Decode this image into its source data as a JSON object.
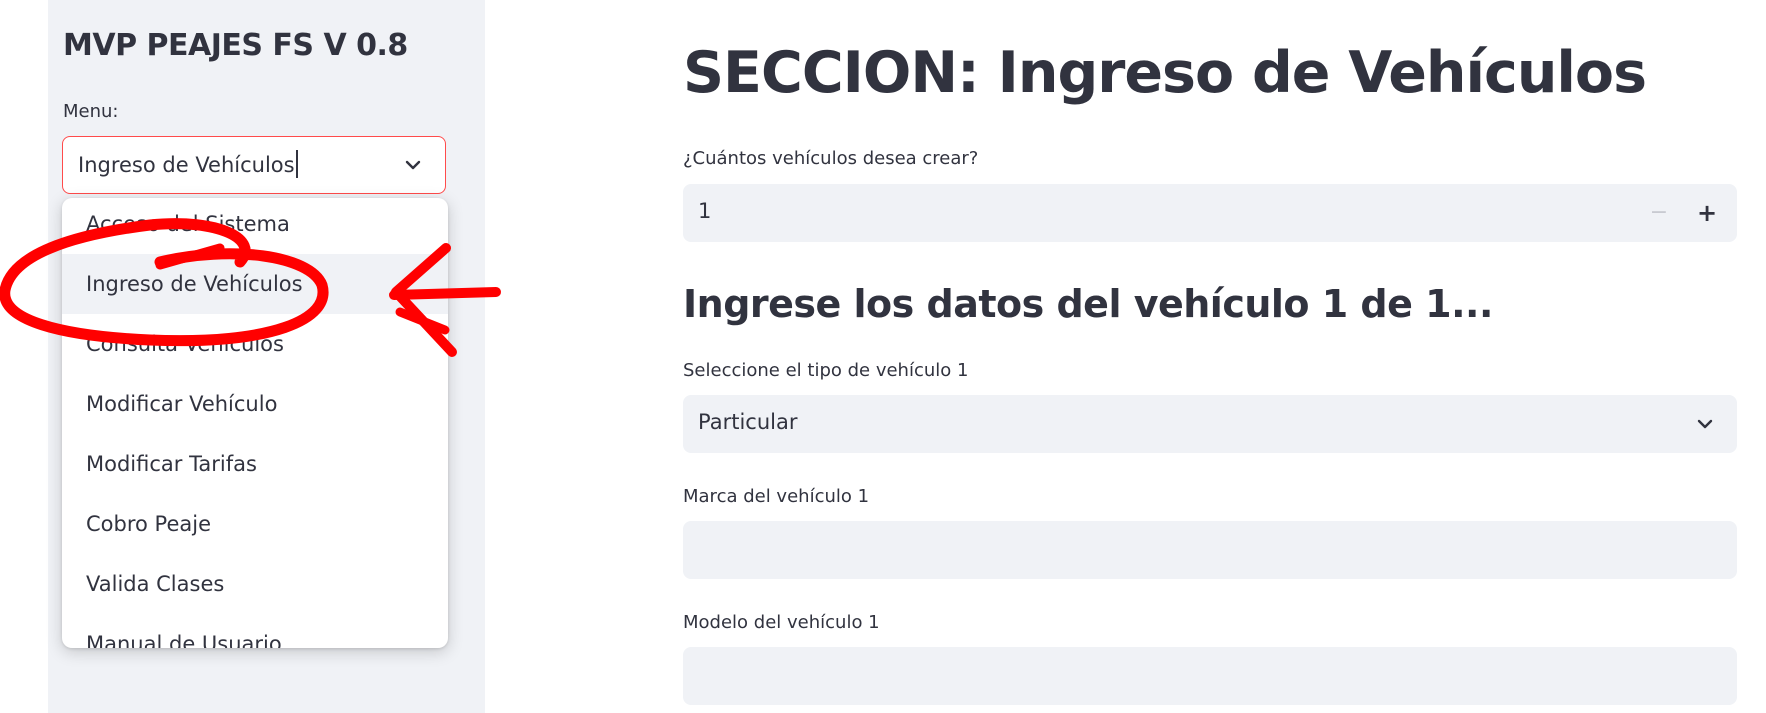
{
  "sidebar": {
    "app_title": "MVP PEAJES FS V 0.8",
    "menu_label": "Menu:",
    "menu_value": "Ingreso de Vehículos",
    "dropdown_items": [
      "Acceso del Sistema",
      "Ingreso de Vehículos",
      "Consulta Vehículos",
      "Modificar Vehículo",
      "Modificar Tarifas",
      "Cobro Peaje",
      "Valida Clases",
      "Manual de Usuario"
    ],
    "selected_index": 1
  },
  "main": {
    "title": "SECCION: Ingreso de Vehículos",
    "count_label": "¿Cuántos vehículos desea crear?",
    "count_value": "1",
    "stepper_minus": "−",
    "stepper_plus": "+",
    "section_heading": "Ingrese los datos del vehículo 1 de 1...",
    "type_label": "Seleccione el tipo de vehículo 1",
    "type_value": "Particular",
    "brand_label": "Marca del vehículo 1",
    "brand_value": "",
    "model_label": "Modelo del vehículo 1",
    "model_value": ""
  },
  "colors": {
    "accent": "#ff4b4b",
    "annotation": "#ff0000",
    "sidebar_bg": "#f0f2f6",
    "text": "#31333f"
  },
  "icons": {
    "menu_chevron": "chevron-down-icon",
    "type_chevron": "chevron-down-icon"
  }
}
